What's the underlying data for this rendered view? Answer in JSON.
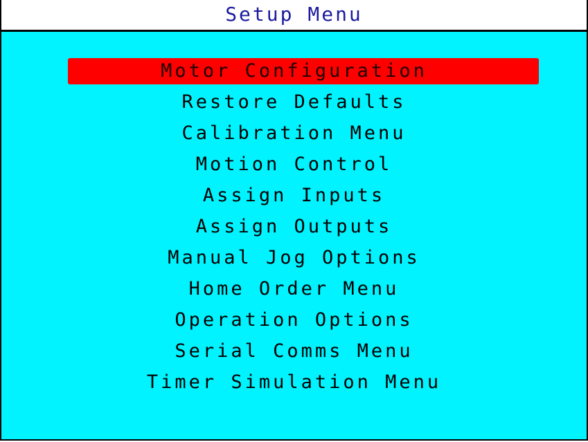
{
  "title": "Setup Menu",
  "colors": {
    "background": "#00f3ff",
    "title_bar": "#ffffff",
    "title_text": "#1a1a9e",
    "selection_highlight": "#ff0000",
    "menu_text": "#000000"
  },
  "selected_index": 0,
  "menu": {
    "items": [
      {
        "label": "Motor Configuration"
      },
      {
        "label": "Restore Defaults"
      },
      {
        "label": "Calibration Menu"
      },
      {
        "label": "Motion Control"
      },
      {
        "label": "Assign Inputs"
      },
      {
        "label": "Assign Outputs"
      },
      {
        "label": "Manual Jog Options"
      },
      {
        "label": "Home Order Menu"
      },
      {
        "label": "Operation Options"
      },
      {
        "label": "Serial Comms Menu"
      },
      {
        "label": "Timer Simulation Menu"
      }
    ]
  }
}
